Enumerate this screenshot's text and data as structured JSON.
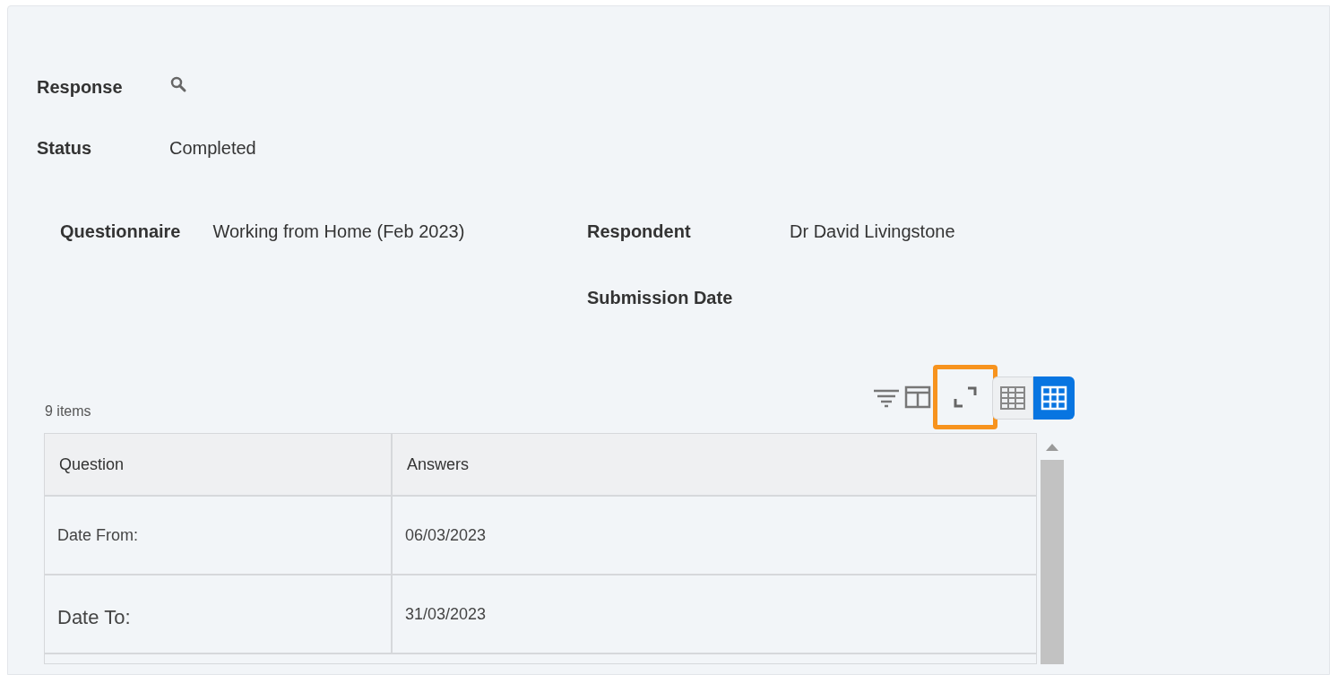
{
  "fields": [
    {
      "label": "Response",
      "kind": "search"
    },
    {
      "label": "Status",
      "kind": "text",
      "value": "Completed"
    }
  ],
  "details": {
    "questionnaire": {
      "label": "Questionnaire",
      "value": "Working from Home (Feb 2023)"
    },
    "respondent": {
      "label": "Respondent",
      "value": "Dr David Livingstone"
    },
    "submission_date": {
      "label": "Submission Date"
    }
  },
  "table": {
    "count": "9 items",
    "tools": [
      {
        "kind": "filter",
        "highlighted": false
      },
      {
        "kind": "columns",
        "highlighted": false
      },
      {
        "kind": "expand",
        "highlighted": true
      }
    ],
    "view_toggles": [
      {
        "kind": "dense",
        "selected": false
      },
      {
        "kind": "grid",
        "selected": true
      }
    ],
    "columns": [
      "Question",
      "Answers"
    ],
    "rows": [
      {
        "question": "Date From:",
        "answer": "06/03/2023",
        "kind": "normal"
      },
      {
        "question": "Date To:",
        "answer": "31/03/2023",
        "kind": "large"
      }
    ]
  }
}
